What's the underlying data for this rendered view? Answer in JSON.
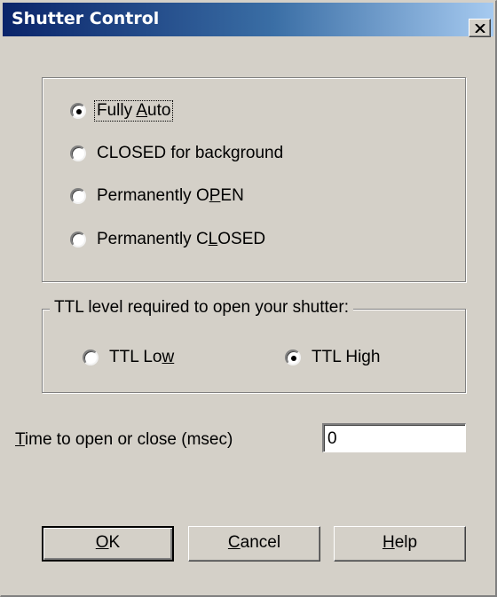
{
  "window": {
    "title": "Shutter Control",
    "close_glyph": "✕"
  },
  "shutter_mode": {
    "options": [
      {
        "pre": "Fully ",
        "accel": "A",
        "post": "uto",
        "selected": true
      },
      {
        "pre": "CLOSED for background",
        "accel": "",
        "post": "",
        "selected": false
      },
      {
        "pre": "Permanently O",
        "accel": "P",
        "post": "EN",
        "selected": false
      },
      {
        "pre": "Permanently C",
        "accel": "L",
        "post": "OSED",
        "selected": false
      }
    ]
  },
  "ttl": {
    "legend": "TTL level required to open your shutter:",
    "options": [
      {
        "pre": "TTL Lo",
        "accel": "w",
        "post": "",
        "selected": false
      },
      {
        "pre": "TTL Hi",
        "accel": "g",
        "post": "h",
        "selected": true
      }
    ]
  },
  "timing": {
    "label_accel": "T",
    "label_rest": "ime to open or close (msec)",
    "value": "0"
  },
  "buttons": {
    "ok": {
      "accel": "O",
      "rest": "K"
    },
    "cancel": {
      "accel": "C",
      "rest": "ancel"
    },
    "help": {
      "accel": "H",
      "rest": "elp"
    }
  },
  "colors": {
    "face": "#d4d0c8",
    "title_start": "#0a246a",
    "title_end": "#a6caf0"
  },
  "icons": {
    "close": "close-icon",
    "radio_selected": "radio-selected-icon",
    "radio_unselected": "radio-unselected-icon"
  }
}
